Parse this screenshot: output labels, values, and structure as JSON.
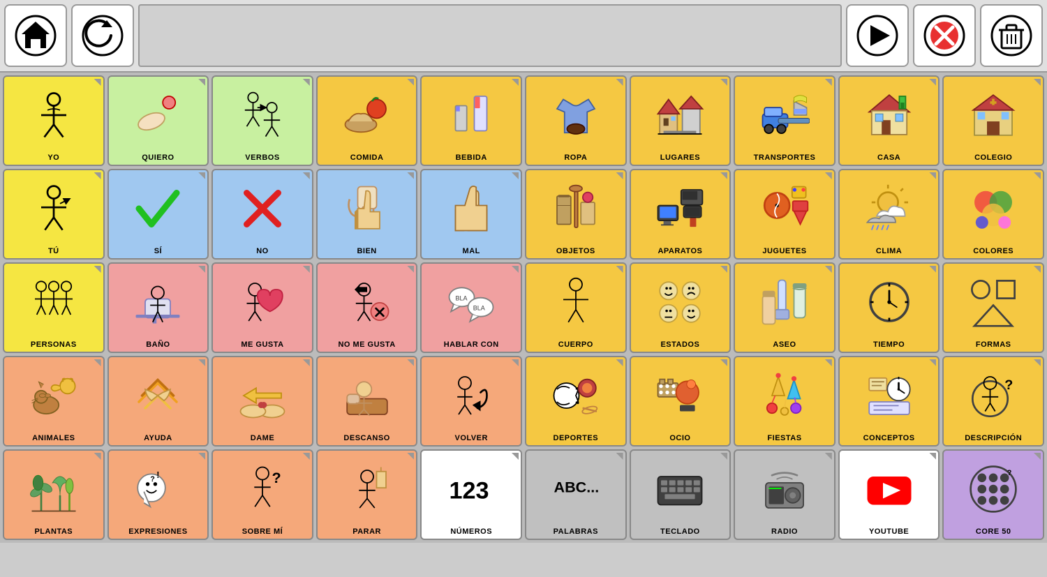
{
  "toolbar": {
    "home_label": "Home",
    "back_label": "Back",
    "play_label": "Play",
    "delete_label": "Delete",
    "trash_label": "Trash"
  },
  "grid": {
    "cells": [
      {
        "id": "yo",
        "label": "YO",
        "color": "yellow",
        "row": 1
      },
      {
        "id": "quiero",
        "label": "QUIERO",
        "color": "green",
        "row": 1
      },
      {
        "id": "verbos",
        "label": "VERBOS",
        "color": "green",
        "row": 1
      },
      {
        "id": "comida",
        "label": "COMIDA",
        "color": "orange",
        "row": 1
      },
      {
        "id": "bebida",
        "label": "BEBIDA",
        "color": "orange",
        "row": 1
      },
      {
        "id": "ropa",
        "label": "ROPA",
        "color": "orange",
        "row": 1
      },
      {
        "id": "lugares",
        "label": "LUGARES",
        "color": "orange",
        "row": 1
      },
      {
        "id": "transportes",
        "label": "TRANSPORTES",
        "color": "orange",
        "row": 1
      },
      {
        "id": "casa",
        "label": "CASA",
        "color": "orange",
        "row": 1
      },
      {
        "id": "colegio",
        "label": "COLEGIO",
        "color": "orange",
        "row": 1
      },
      {
        "id": "tu",
        "label": "TÚ",
        "color": "yellow",
        "row": 2
      },
      {
        "id": "si",
        "label": "SÍ",
        "color": "blue",
        "row": 2
      },
      {
        "id": "no",
        "label": "NO",
        "color": "blue",
        "row": 2
      },
      {
        "id": "bien",
        "label": "BIEN",
        "color": "blue",
        "row": 2
      },
      {
        "id": "mal",
        "label": "MAL",
        "color": "blue",
        "row": 2
      },
      {
        "id": "objetos",
        "label": "OBJETOS",
        "color": "orange",
        "row": 2
      },
      {
        "id": "aparatos",
        "label": "APARATOS",
        "color": "orange",
        "row": 2
      },
      {
        "id": "juguetes",
        "label": "JUGUETES",
        "color": "orange",
        "row": 2
      },
      {
        "id": "clima",
        "label": "CLIMA",
        "color": "orange",
        "row": 2
      },
      {
        "id": "colores",
        "label": "COLORES",
        "color": "orange",
        "row": 2
      },
      {
        "id": "personas",
        "label": "PERSONAS",
        "color": "yellow",
        "row": 3
      },
      {
        "id": "bano",
        "label": "BAÑO",
        "color": "pink",
        "row": 3
      },
      {
        "id": "me_gusta",
        "label": "ME GUSTA",
        "color": "pink",
        "row": 3
      },
      {
        "id": "no_me_gusta",
        "label": "NO ME GUSTA",
        "color": "pink",
        "row": 3
      },
      {
        "id": "hablar_con",
        "label": "HABLAR CON",
        "color": "pink",
        "row": 3
      },
      {
        "id": "cuerpo",
        "label": "CUERPO",
        "color": "orange",
        "row": 3
      },
      {
        "id": "estados",
        "label": "ESTADOS",
        "color": "orange",
        "row": 3
      },
      {
        "id": "aseo",
        "label": "ASEO",
        "color": "orange",
        "row": 3
      },
      {
        "id": "tiempo",
        "label": "TIEMPO",
        "color": "orange",
        "row": 3
      },
      {
        "id": "formas",
        "label": "FORMAS",
        "color": "orange",
        "row": 3
      },
      {
        "id": "animales",
        "label": "ANIMALES",
        "color": "salmon",
        "row": 4
      },
      {
        "id": "ayuda",
        "label": "AYUDA",
        "color": "salmon",
        "row": 4
      },
      {
        "id": "dame",
        "label": "DAME",
        "color": "salmon",
        "row": 4
      },
      {
        "id": "descanso",
        "label": "DESCANSO",
        "color": "salmon",
        "row": 4
      },
      {
        "id": "volver",
        "label": "VOLVER",
        "color": "salmon",
        "row": 4
      },
      {
        "id": "deportes",
        "label": "DEPORTES",
        "color": "orange",
        "row": 4
      },
      {
        "id": "ocio",
        "label": "OCIO",
        "color": "orange",
        "row": 4
      },
      {
        "id": "fiestas",
        "label": "FIESTAS",
        "color": "orange",
        "row": 4
      },
      {
        "id": "conceptos",
        "label": "CONCEPTOS",
        "color": "orange",
        "row": 4
      },
      {
        "id": "descripcion",
        "label": "DESCRIPCIÓN",
        "color": "orange",
        "row": 4
      },
      {
        "id": "plantas",
        "label": "PLANTAS",
        "color": "salmon",
        "row": 5
      },
      {
        "id": "expresiones",
        "label": "EXPRESIONES",
        "color": "salmon",
        "row": 5
      },
      {
        "id": "sobre_mi",
        "label": "SOBRE MÍ",
        "color": "salmon",
        "row": 5
      },
      {
        "id": "parar",
        "label": "PARAR",
        "color": "salmon",
        "row": 5
      },
      {
        "id": "numeros",
        "label": "NÚMEROS",
        "color": "white",
        "row": 5
      },
      {
        "id": "palabras",
        "label": "PALABRAS",
        "color": "gray",
        "row": 5
      },
      {
        "id": "teclado",
        "label": "TECLADO",
        "color": "gray",
        "row": 5
      },
      {
        "id": "radio",
        "label": "RADIO",
        "color": "gray",
        "row": 5
      },
      {
        "id": "youtube",
        "label": "YOUTUBE",
        "color": "white",
        "row": 5
      },
      {
        "id": "core50",
        "label": "CORE 50",
        "color": "purple",
        "row": 5
      }
    ]
  }
}
